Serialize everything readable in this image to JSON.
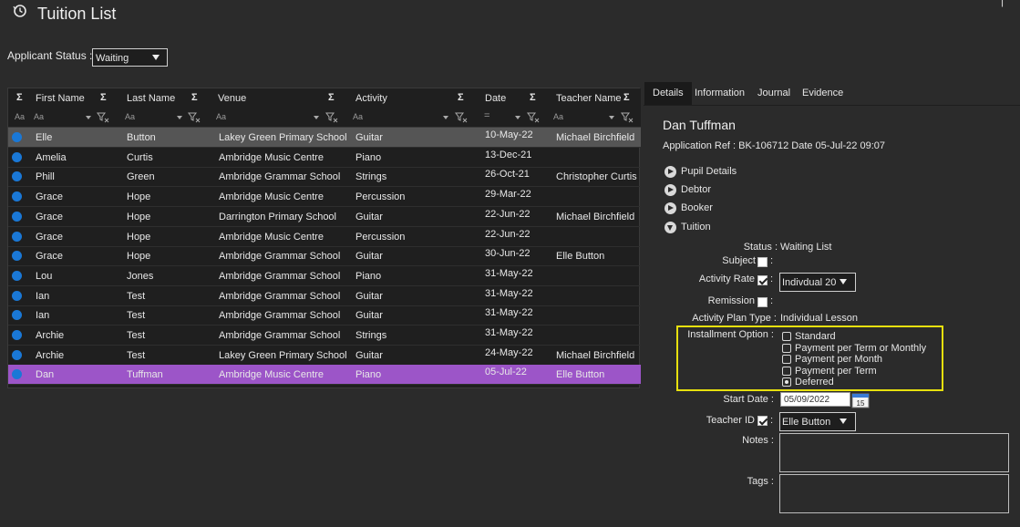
{
  "header": {
    "title": "Tuition List",
    "corner_glyph": "|"
  },
  "filter": {
    "label": "Applicant Status :",
    "value": "Waiting"
  },
  "grid": {
    "columns": [
      "First Name",
      "Last Name",
      "Venue",
      "Activity",
      "Date",
      "Teacher Name"
    ],
    "filter_placeholder": "Aa",
    "filter_equals": "=",
    "rows": [
      {
        "first": "Elle",
        "last": "Button",
        "venue": "Lakey Green Primary School",
        "activity": "Guitar",
        "date": "10-May-22",
        "teacher": "Michael Birchfield"
      },
      {
        "first": "Amelia",
        "last": "Curtis",
        "venue": "Ambridge Music Centre",
        "activity": "Piano",
        "date": "13-Dec-21",
        "teacher": ""
      },
      {
        "first": "Phill",
        "last": "Green",
        "venue": "Ambridge Grammar School",
        "activity": "Strings",
        "date": "26-Oct-21",
        "teacher": "Christopher Curtis"
      },
      {
        "first": "Grace",
        "last": "Hope",
        "venue": "Ambridge Music Centre",
        "activity": "Percussion",
        "date": "29-Mar-22",
        "teacher": ""
      },
      {
        "first": "Grace",
        "last": "Hope",
        "venue": "Darrington Primary School",
        "activity": "Guitar",
        "date": "22-Jun-22",
        "teacher": "Michael Birchfield"
      },
      {
        "first": "Grace",
        "last": "Hope",
        "venue": "Ambridge Music Centre",
        "activity": "Percussion",
        "date": "22-Jun-22",
        "teacher": ""
      },
      {
        "first": "Grace",
        "last": "Hope",
        "venue": "Ambridge Grammar School",
        "activity": "Guitar",
        "date": "30-Jun-22",
        "teacher": "Elle Button"
      },
      {
        "first": "Lou",
        "last": "Jones",
        "venue": "Ambridge Grammar School",
        "activity": "Piano",
        "date": "31-May-22",
        "teacher": ""
      },
      {
        "first": "Ian",
        "last": "Test",
        "venue": "Ambridge Grammar School",
        "activity": "Guitar",
        "date": "31-May-22",
        "teacher": ""
      },
      {
        "first": "Ian",
        "last": "Test",
        "venue": "Ambridge Grammar School",
        "activity": "Guitar",
        "date": "31-May-22",
        "teacher": ""
      },
      {
        "first": "Archie",
        "last": "Test",
        "venue": "Ambridge Grammar School",
        "activity": "Strings",
        "date": "31-May-22",
        "teacher": ""
      },
      {
        "first": "Archie",
        "last": "Test",
        "venue": "Lakey Green Primary School",
        "activity": "Guitar",
        "date": "24-May-22",
        "teacher": "Michael Birchfield"
      },
      {
        "first": "Dan",
        "last": "Tuffman",
        "venue": "Ambridge Music Centre",
        "activity": "Piano",
        "date": "05-Jul-22",
        "teacher": "Elle Button"
      }
    ]
  },
  "panel": {
    "tabs": [
      "Details",
      "Information",
      "Journal",
      "Evidence"
    ],
    "name": "Dan Tuffman",
    "app_ref": "Application Ref : BK-106712 Date 05-Jul-22 09:07",
    "sections": [
      "Pupil Details",
      "Debtor",
      "Booker",
      "Tuition"
    ],
    "status_label": "Status :",
    "status_value": "Waiting List",
    "subject_label": "Subject",
    "activity_rate_label": "Activity Rate",
    "activity_rate_value": "Indivdual 20",
    "remission_label": "Remission",
    "plan_type_label": "Activity Plan Type :",
    "plan_type_value": "Individual Lesson",
    "install_label": "Installment Option :",
    "install_options": [
      "Standard",
      "Payment per Term or Monthly",
      "Payment per Month",
      "Payment per Term",
      "Deferred"
    ],
    "start_date_label": "Start Date :",
    "start_date_value": "05/09/2022",
    "cal_day": "15",
    "teacher_id_label": "Teacher ID",
    "teacher_id_value": "Elle Button",
    "notes_label": "Notes :",
    "tags_label": "Tags :",
    "colon": ":"
  },
  "colors": {
    "accent_row": "#9c55c8",
    "dot": "#1a78d6",
    "highlight": "#e7e00e"
  }
}
